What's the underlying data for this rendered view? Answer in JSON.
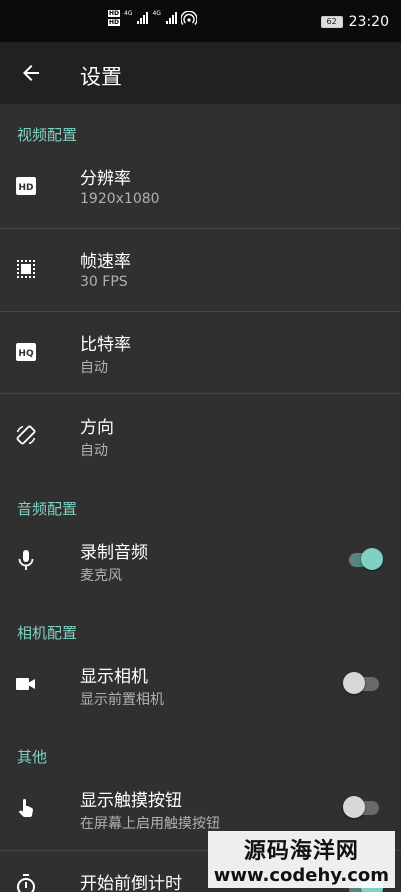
{
  "status_bar": {
    "time": "23:20",
    "battery": "62",
    "network": [
      "4G",
      "4G"
    ],
    "icons": [
      "hd-icon",
      "signal-icon",
      "signal-icon",
      "hotspot-icon"
    ]
  },
  "header": {
    "title": "设置",
    "back_icon": "arrow-left-icon"
  },
  "sections": {
    "video": "视频配置",
    "audio": "音频配置",
    "camera": "相机配置",
    "other": "其他"
  },
  "items": {
    "resolution": {
      "title": "分辨率",
      "value": "1920x1080",
      "icon": "hd-icon"
    },
    "framerate": {
      "title": "帧速率",
      "value": "30 FPS",
      "icon": "frame-icon"
    },
    "bitrate": {
      "title": "比特率",
      "value": "自动",
      "icon": "hq-icon"
    },
    "orientation": {
      "title": "方向",
      "value": "自动",
      "icon": "screen-rotation-icon"
    },
    "record_audio": {
      "title": "录制音频",
      "value": "麦克风",
      "icon": "microphone-icon",
      "enabled": true
    },
    "show_camera": {
      "title": "显示相机",
      "value": "显示前置相机",
      "icon": "videocam-icon",
      "enabled": false
    },
    "touch_button": {
      "title": "显示触摸按钮",
      "value": "在屏幕上启用触摸按钮",
      "icon": "touch-icon",
      "enabled": false
    },
    "countdown": {
      "title": "开始前倒计时",
      "icon": "timer-icon",
      "enabled": true
    }
  },
  "watermark": {
    "line1": "源码海洋网",
    "line2": "www.codehy.com"
  },
  "colors": {
    "accent": "#7fd0c5",
    "background": "#303030",
    "appbar": "#212121"
  }
}
